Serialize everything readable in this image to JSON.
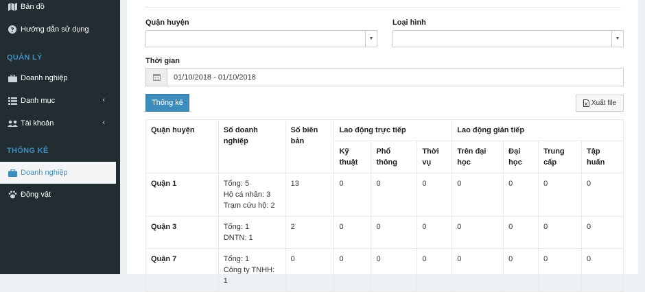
{
  "sidebar": {
    "map_label": "Bản đồ",
    "guide_label": "Hướng dẫn sử dụng",
    "section_manage": "QUẢN LÝ",
    "manage_business": "Doanh nghiệp",
    "manage_category": "Danh mục",
    "manage_account": "Tài khoản",
    "section_stats": "THỐNG KÊ",
    "stats_business": "Doanh nghiệp",
    "stats_animal": "Động vật"
  },
  "filters": {
    "district_label": "Quận huyện",
    "district_value": "",
    "type_label": "Loại hình",
    "type_value": "",
    "time_label": "Thời gian",
    "time_value": "01/10/2018 - 01/10/2018"
  },
  "buttons": {
    "stats": "Thống kê",
    "export": "Xuất file"
  },
  "table": {
    "h_district": "Quận huyện",
    "h_business_count": "Số doanh nghiệp",
    "h_minutes": "Số biên bản",
    "h_direct": "Lao động trực tiếp",
    "h_indirect": "Lao động gián tiếp",
    "h_technical": "Kỹ thuật",
    "h_general": "Phổ thông",
    "h_seasonal": "Thời vụ",
    "h_above_univ": "Trên đại học",
    "h_univ": "Đại học",
    "h_college": "Trung cấp",
    "h_trainee": "Tập huấn",
    "rows": [
      {
        "district": "Quận 1",
        "business": [
          "Tổng: 5",
          "Hộ cá nhân: 3",
          "Trạm cứu hộ: 2"
        ],
        "minutes": "13",
        "technical": "0",
        "general": "0",
        "seasonal": "0",
        "above_univ": "0",
        "univ": "0",
        "college": "0",
        "trainee": "0"
      },
      {
        "district": "Quận 3",
        "business": [
          "Tổng: 1",
          "DNTN: 1"
        ],
        "minutes": "2",
        "technical": "0",
        "general": "0",
        "seasonal": "0",
        "above_univ": "0",
        "univ": "0",
        "college": "0",
        "trainee": "0"
      },
      {
        "district": "Quận 7",
        "business": [
          "Tổng: 1",
          "Công ty TNHH: 1"
        ],
        "minutes": "0",
        "technical": "0",
        "general": "0",
        "seasonal": "0",
        "above_univ": "0",
        "univ": "0",
        "college": "0",
        "trainee": "0"
      }
    ]
  }
}
